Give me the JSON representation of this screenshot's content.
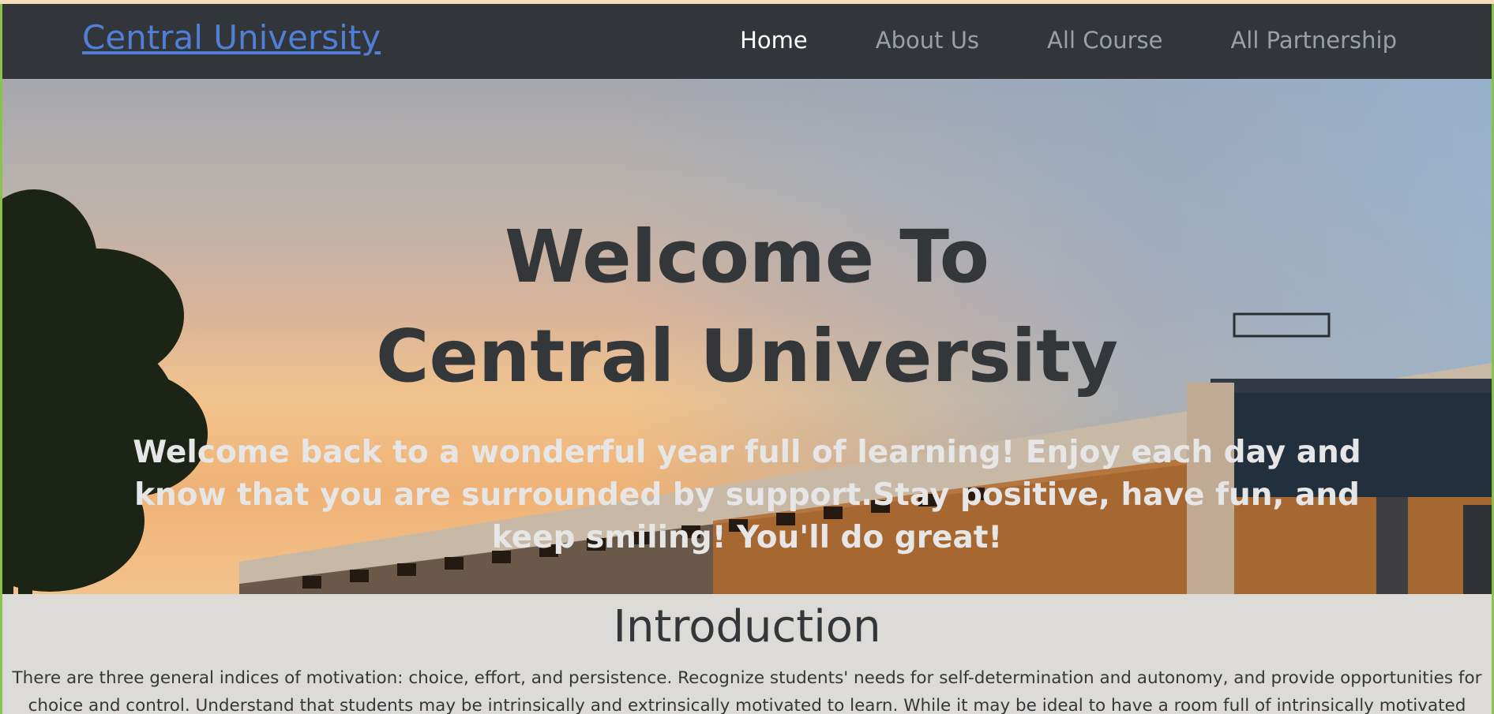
{
  "navbar": {
    "brand": "Central University",
    "items": [
      {
        "label": "Home",
        "active": true
      },
      {
        "label": "About Us",
        "active": false
      },
      {
        "label": "All Course",
        "active": false
      },
      {
        "label": "All Partnership",
        "active": false
      }
    ]
  },
  "hero": {
    "title_line1": "Welcome To",
    "title_line2": "Central University",
    "subtitle": "Welcome back to a wonderful year full of learning! Enjoy each day and know that you are surrounded by support.Stay positive, have fun, and keep smiling! You'll do great!"
  },
  "intro": {
    "title": "Introduction",
    "text": "There are three general indices of motivation: choice, effort, and persistence. Recognize students' needs for self-determination and autonomy, and provide opportunities for choice and control. Understand that students may be intrinsically and extrinsically motivated to learn. While it may be ideal to have a room full of intrinsically motivated students, it is"
  },
  "colors": {
    "navbar_bg": "#32363a",
    "brand": "#4f7fd6",
    "nav_active": "#ffffff",
    "nav_inactive": "#9ba0a5",
    "heading": "#34373a",
    "page_bg": "#dcdbd8"
  }
}
